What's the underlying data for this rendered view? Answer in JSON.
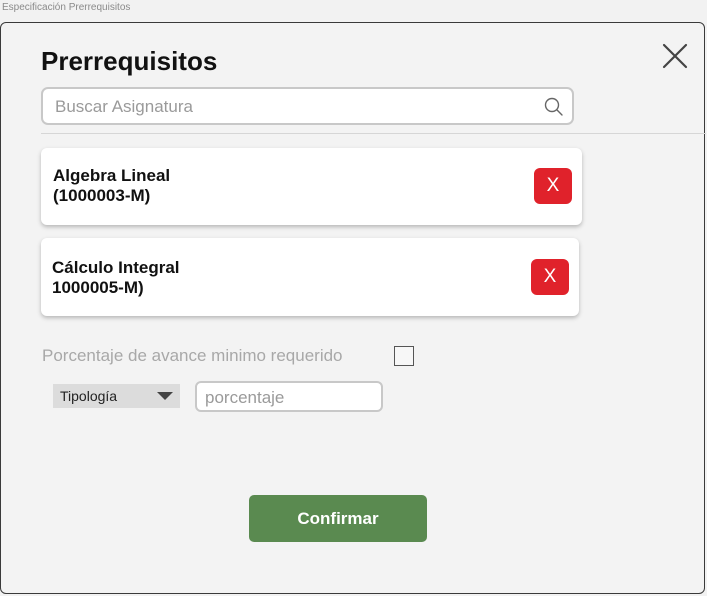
{
  "frame_label": "Especificación Prerrequisitos",
  "dialog": {
    "title": "Prerrequisitos",
    "close_icon": "close-icon"
  },
  "search": {
    "placeholder": "Buscar Asignatura",
    "value": "",
    "icon": "search-icon"
  },
  "prerequisites": [
    {
      "name": "Algebra Lineal",
      "code": "(1000003-M)",
      "remove_label": "X"
    },
    {
      "name": "Cálculo Integral",
      "code": "1000005-M)",
      "remove_label": "X"
    }
  ],
  "percentage": {
    "label": "Porcentaje de avance minimo requerido",
    "checked": false,
    "typology_label": "Tipología",
    "typology_caret_icon": "caret-down-icon",
    "input_placeholder": "porcentaje",
    "input_value": ""
  },
  "actions": {
    "confirm_label": "Confirmar"
  },
  "colors": {
    "remove_button": "#e0222b",
    "confirm_button": "#5a8a50",
    "dialog_background": "#f3f3f3"
  }
}
